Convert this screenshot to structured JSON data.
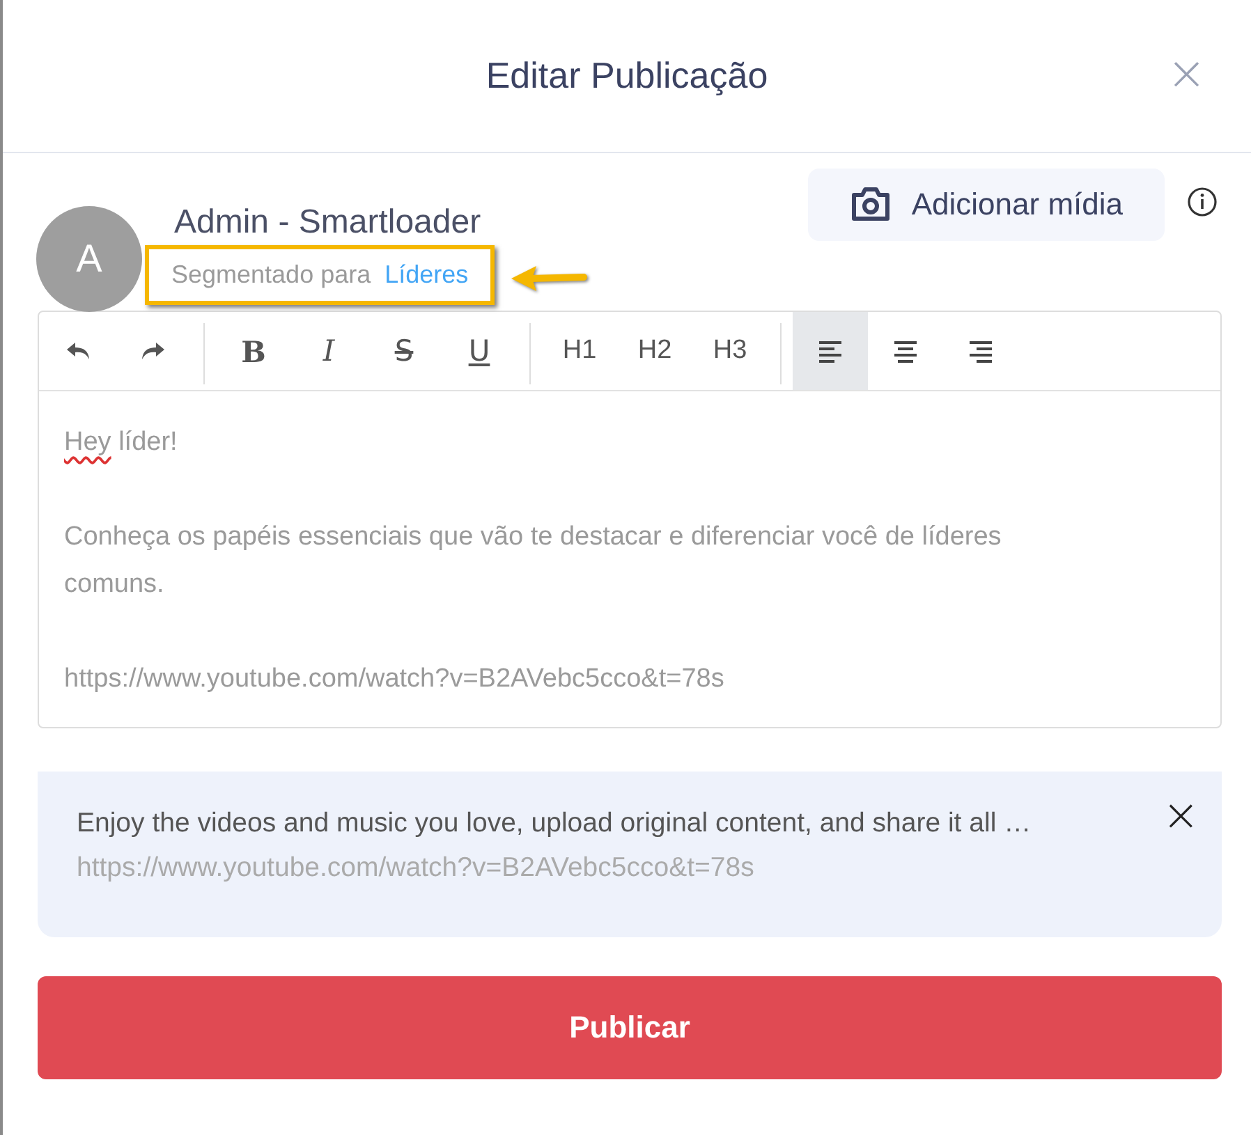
{
  "dialog": {
    "title": "Editar Publicação",
    "close": "×"
  },
  "author": {
    "avatar_letter": "A",
    "name": "Admin - Smartloader",
    "segment_label": "Segmentado para",
    "segment_value": "Líderes",
    "highlighted": true
  },
  "media_button": {
    "label": "Adicionar mídia"
  },
  "toolbar": [
    [
      {
        "kind": "history",
        "selected": false
      },
      {
        "kind": "history",
        "selected": false
      }
    ],
    [
      {
        "kind": "format",
        "label": "B",
        "selected": false
      },
      {
        "kind": "format",
        "label": "I",
        "selected": false
      },
      {
        "kind": "format",
        "label": "S",
        "selected": false
      },
      {
        "kind": "format",
        "label": "U",
        "selected": false
      }
    ],
    [
      {
        "kind": "text",
        "label": "H1",
        "selected": false
      },
      {
        "kind": "text",
        "label": "H2",
        "selected": false
      },
      {
        "kind": "text",
        "label": "H3",
        "selected": false
      }
    ],
    [
      {
        "kind": "align",
        "selected": true
      },
      {
        "kind": "align",
        "selected": false
      },
      {
        "kind": "align",
        "selected": false
      }
    ]
  ],
  "content": [
    {
      "text": "Hey líder!",
      "misspelled_first_word": true
    },
    {
      "text": "Conheça os papéis essenciais que vão te destacar e diferenciar você de líderes comuns.",
      "misspelled_first_word": false
    },
    {
      "text": "https://www.youtube.com/watch?v=B2AVebc5cco&t=78s",
      "misspelled_first_word": false
    }
  ],
  "link_preview": {
    "description": "Enjoy the videos and music you love, upload original content, and share it all …",
    "url": "https://www.youtube.com/watch?v=B2AVebc5cco&t=78s",
    "close": "×"
  },
  "publish_button": {
    "label": "Publicar"
  }
}
